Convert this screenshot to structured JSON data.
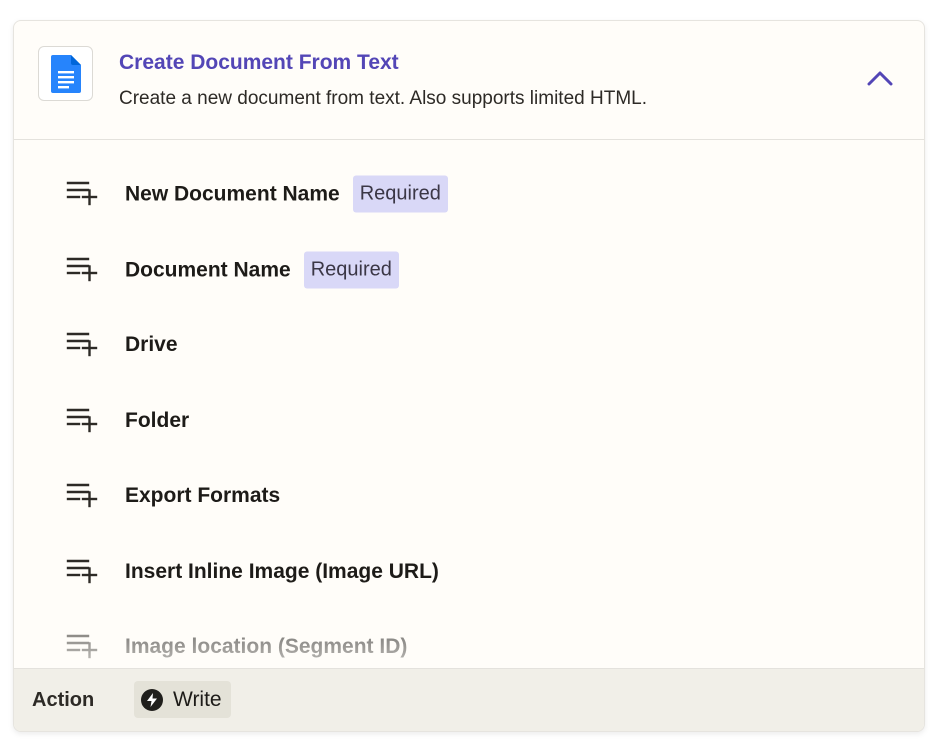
{
  "header": {
    "app_icon": "google-docs-icon",
    "title": "Create Document From Text",
    "description": "Create a new document from text. Also supports limited HTML.",
    "collapse_icon": "chevron-up-icon",
    "accent_color": "#5346b6"
  },
  "fields": [
    {
      "label": "New Document Name",
      "required": "Required"
    },
    {
      "label": "Document Name",
      "required": "Required"
    },
    {
      "label": "Drive",
      "required": ""
    },
    {
      "label": "Folder",
      "required": ""
    },
    {
      "label": "Export Formats",
      "required": ""
    },
    {
      "label": "Insert Inline Image (Image URL)",
      "required": ""
    },
    {
      "label": "Image location (Segment ID)",
      "required": ""
    }
  ],
  "field_icon": "playlist-add-icon",
  "footer": {
    "label": "Action",
    "chip_icon": "bolt-icon",
    "chip_label": "Write"
  },
  "colors": {
    "badge_bg": "#d9d8f7",
    "card_bg": "#fffdf9",
    "footer_bg": "#f1efe8"
  }
}
